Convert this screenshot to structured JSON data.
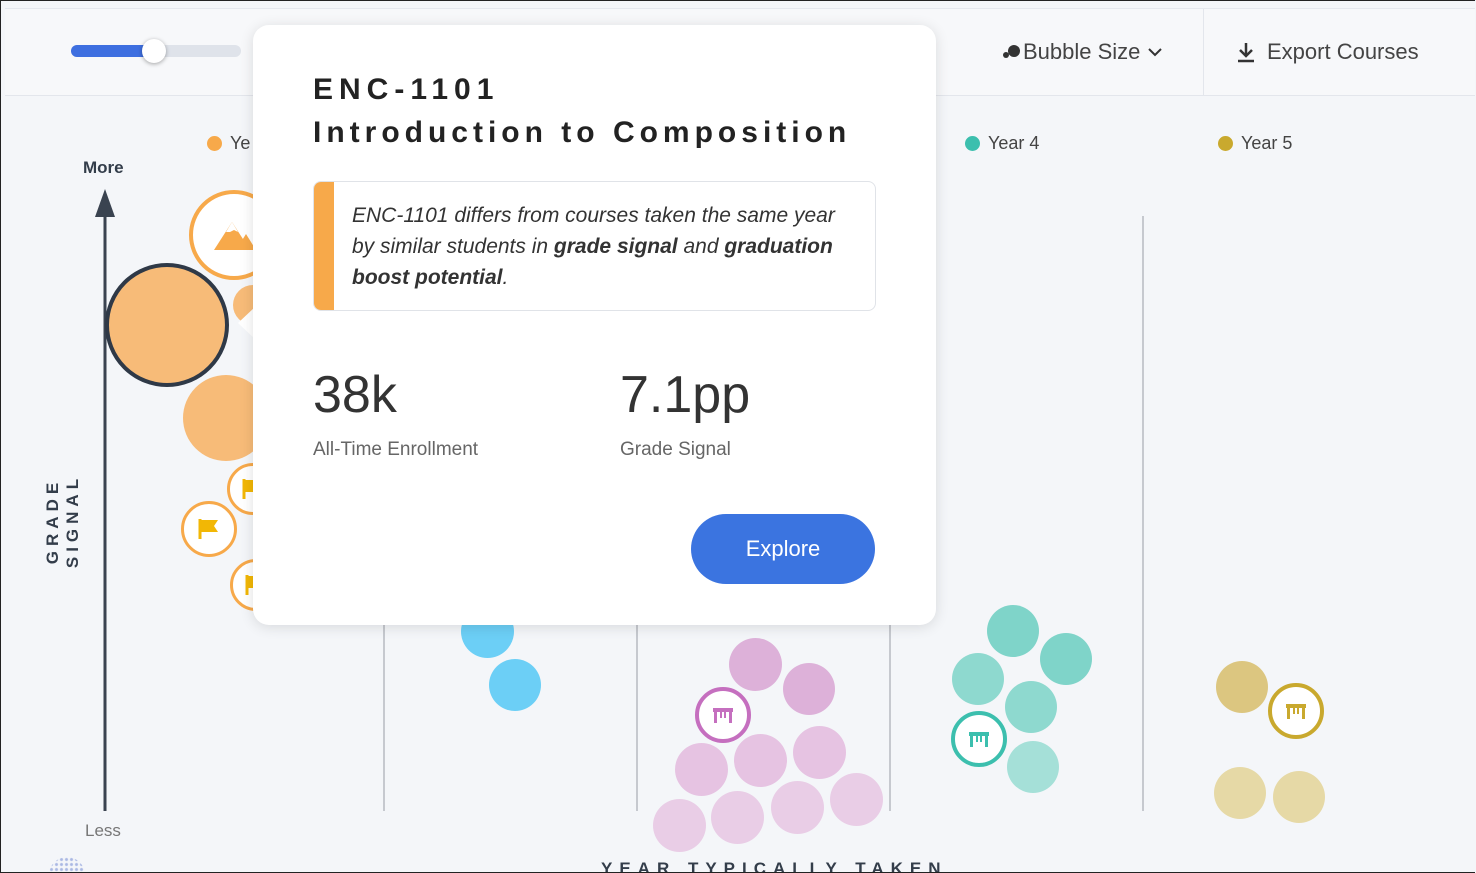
{
  "toolbar": {
    "slider_level_percent": 49,
    "bubble_size_label": "Bubble Size",
    "export_label": "Export Courses"
  },
  "legend": {
    "year1": "Ye",
    "year4": "Year 4",
    "year5": "Year 5"
  },
  "colors": {
    "year1": "#f7a94a",
    "year2": "#6ccff6",
    "year3": "#c98fc9",
    "year4": "#4fc3b5",
    "year5": "#c9a92e",
    "accent": "#3b74e0"
  },
  "chart": {
    "y_axis_label": "GRADE SIGNAL",
    "y_more": "More",
    "y_less": "Less",
    "x_axis_label": "YEAR TYPICALLY TAKEN"
  },
  "popup": {
    "course_code": "ENC-1101",
    "course_name": "Introduction to Composition",
    "callout_lead": "ENC-1101 differs from courses taken the same year by similar students in ",
    "callout_bold1": "grade signal",
    "callout_mid": " and ",
    "callout_bold2": "graduation boost potential",
    "callout_end": ".",
    "enrollment_value": "38k",
    "enrollment_label": "All-Time Enrollment",
    "grade_signal_value": "7.1pp",
    "grade_signal_label": "Grade Signal",
    "explore_label": "Explore"
  },
  "icons": {
    "mountain": "mountain-icon",
    "flag": "flag-icon",
    "gate": "gate-icon",
    "download": "download-icon",
    "bubble_size": "bubbles-icon",
    "chevron": "chevron-down-icon"
  }
}
